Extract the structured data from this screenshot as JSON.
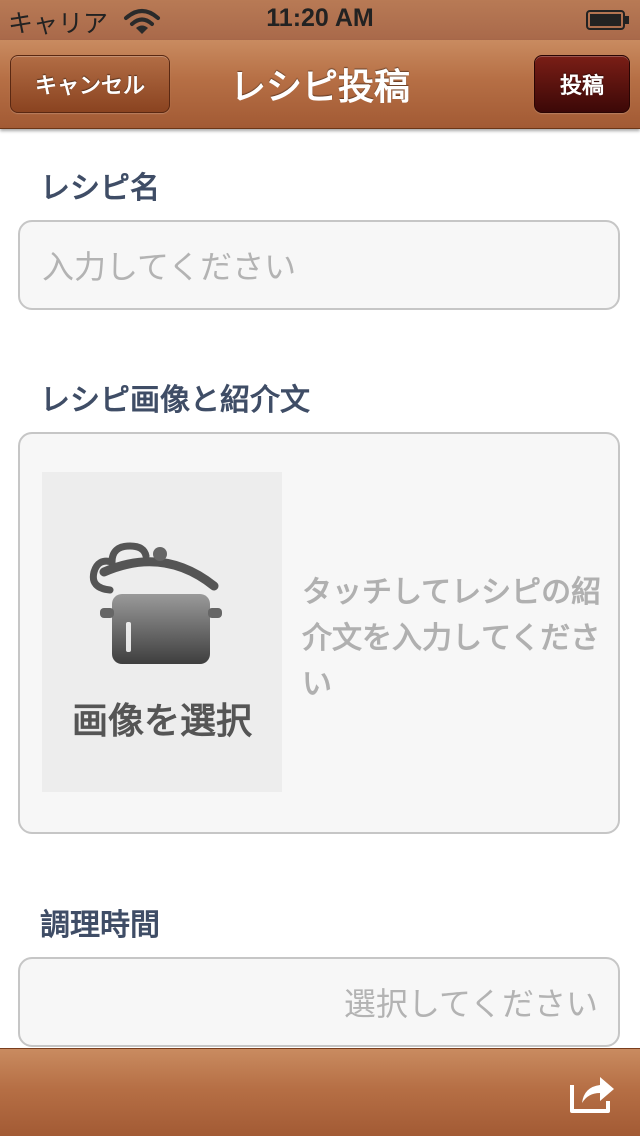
{
  "status_bar": {
    "carrier": "キャリア",
    "time": "11:20 AM",
    "wifi_icon": "wifi-icon",
    "battery_icon": "battery-icon"
  },
  "nav": {
    "title": "レシピ投稿",
    "cancel_label": "キャンセル",
    "post_label": "投稿"
  },
  "recipe_name": {
    "label": "レシピ名",
    "placeholder": "入力してください",
    "value": ""
  },
  "image_intro": {
    "label": "レシピ画像と紹介文",
    "image_button_label": "画像を選択",
    "image_icon": "cooking-pot-icon",
    "intro_placeholder": "タッチしてレシピの紹介文を入力してください"
  },
  "cook_time": {
    "label": "調理時間",
    "placeholder": "選択してください"
  },
  "toolbar": {
    "share_icon": "share-icon"
  },
  "colors": {
    "bar_brown": "#b66f45",
    "post_button": "#5a0f0b",
    "label_text": "#3f4d66",
    "placeholder_text": "#b3b3b3"
  }
}
